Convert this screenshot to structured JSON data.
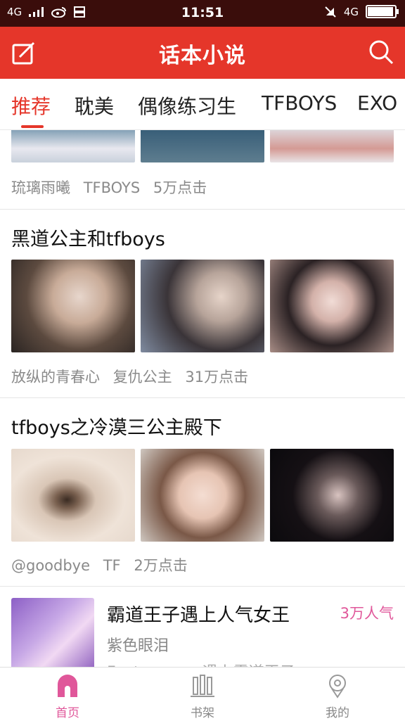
{
  "status_bar": {
    "network": "4G",
    "time": "11:51",
    "right_network": "4G",
    "battery_level": 0.95
  },
  "app_bar": {
    "title": "话本小说",
    "edit_icon": "edit-icon",
    "search_icon": "search-icon",
    "background": "#e5362a"
  },
  "tabs": [
    {
      "label": "推荐",
      "active": true
    },
    {
      "label": "耽美",
      "active": false
    },
    {
      "label": "偶像练习生",
      "active": false
    },
    {
      "label": "TFBOYS",
      "active": false
    },
    {
      "label": "EXO",
      "active": false
    }
  ],
  "stories": [
    {
      "title": "",
      "author": "琉璃雨曦",
      "category": "TFBOYS",
      "clicks": "5万点击"
    },
    {
      "title": "黑道公主和tfboys",
      "author": "放纵的青春心",
      "category": "复仇公主",
      "clicks": "31万点击"
    },
    {
      "title": "tfboys之冷漠三公主殿下",
      "author": "@goodbye",
      "category": "TF",
      "clicks": "2万点击"
    }
  ],
  "book": {
    "title": "霸道王子遇上人气女王",
    "author": "紫色眼泪",
    "description": "Fantasy……·遇上霸道王子",
    "popularity": "3万人气"
  },
  "bottom_nav": [
    {
      "label": "首页",
      "icon": "home-icon",
      "active": true
    },
    {
      "label": "书架",
      "icon": "bookshelf-icon",
      "active": false
    },
    {
      "label": "我的",
      "icon": "profile-icon",
      "active": false
    }
  ],
  "colors": {
    "accent": "#e5362a",
    "pink": "#e0579a"
  }
}
